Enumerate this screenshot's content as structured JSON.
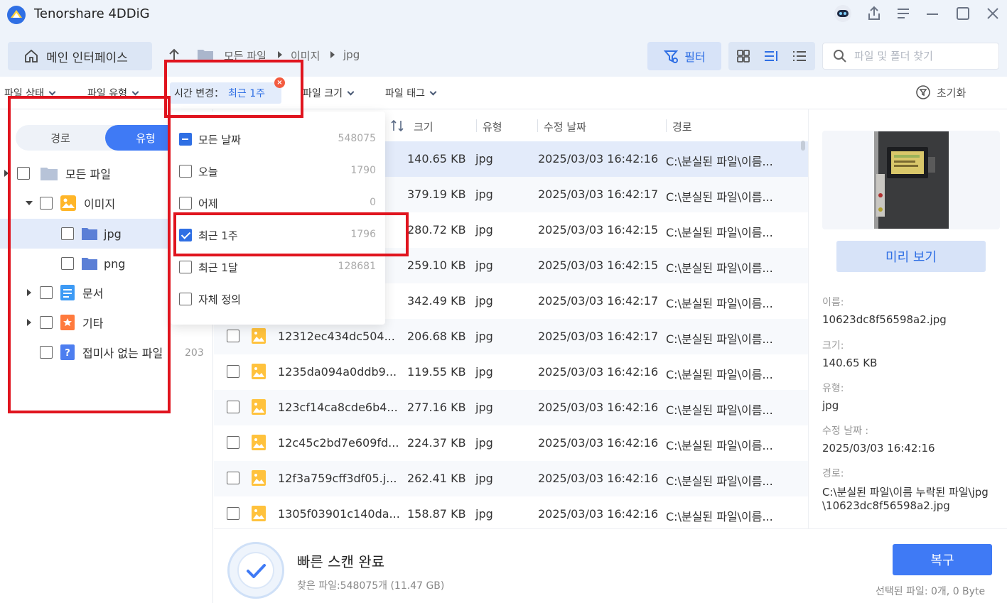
{
  "app": {
    "title": "Tenorshare 4DDiG"
  },
  "toolbar": {
    "home_label": "메인 인터페이스",
    "breadcrumb": [
      "모든 파일",
      "이미지",
      "jpg"
    ],
    "filter_label": "필터",
    "search_placeholder": "파일 및 폴더 찾기"
  },
  "filterbar": {
    "file_status": "파일 상태",
    "file_type": "파일 유형",
    "time_label": "시간 변경：",
    "time_value": "최근 1주",
    "file_size": "파일 크기",
    "file_tag": "파일 태그",
    "reset": "초기화"
  },
  "sidebar": {
    "tab_path": "경로",
    "tab_type": "유형",
    "items": [
      {
        "label": "모든 파일",
        "count": ""
      },
      {
        "label": "이미지",
        "count": ""
      },
      {
        "label": "jpg",
        "count": ""
      },
      {
        "label": "png",
        "count": ""
      },
      {
        "label": "문서",
        "count": ""
      },
      {
        "label": "기타",
        "count": ""
      },
      {
        "label": "접미사 없는 파일",
        "count": "203"
      }
    ]
  },
  "dropdown": {
    "options": [
      {
        "label": "모든 날짜",
        "count": "548075",
        "state": "partial"
      },
      {
        "label": "오늘",
        "count": "1790",
        "state": "unchecked"
      },
      {
        "label": "어제",
        "count": "0",
        "state": "unchecked"
      },
      {
        "label": "최근 1주",
        "count": "1796",
        "state": "checked"
      },
      {
        "label": "최근 1달",
        "count": "128681",
        "state": "unchecked"
      },
      {
        "label": "자체 정의",
        "count": "",
        "state": "unchecked"
      }
    ]
  },
  "table": {
    "columns": [
      "크기",
      "유형",
      "수정 날짜",
      "경로"
    ],
    "rows": [
      {
        "name": "",
        "size": "140.65 KB",
        "type": "jpg",
        "date": "2025/03/03 16:42:16",
        "path": "C:\\분실된 파일\\이름..."
      },
      {
        "name": "",
        "size": "379.19 KB",
        "type": "jpg",
        "date": "2025/03/03 16:42:17",
        "path": "C:\\분실된 파일\\이름..."
      },
      {
        "name": "",
        "size": "280.72 KB",
        "type": "jpg",
        "date": "2025/03/03 16:42:15",
        "path": "C:\\분실된 파일\\이름..."
      },
      {
        "name": "",
        "size": "259.10 KB",
        "type": "jpg",
        "date": "2025/03/03 16:42:15",
        "path": "C:\\분실된 파일\\이름..."
      },
      {
        "name": "",
        "size": "342.49 KB",
        "type": "jpg",
        "date": "2025/03/03 16:42:17",
        "path": "C:\\분실된 파일\\이름..."
      },
      {
        "name": "12312ec434dc504...",
        "size": "206.68 KB",
        "type": "jpg",
        "date": "2025/03/03 16:42:17",
        "path": "C:\\분실된 파일\\이름..."
      },
      {
        "name": "1235da094a0ddb9...",
        "size": "119.55 KB",
        "type": "jpg",
        "date": "2025/03/03 16:42:16",
        "path": "C:\\분실된 파일\\이름..."
      },
      {
        "name": "123cf14ca8cde6b4...",
        "size": "277.16 KB",
        "type": "jpg",
        "date": "2025/03/03 16:42:16",
        "path": "C:\\분실된 파일\\이름..."
      },
      {
        "name": "12c45c2bd7e609fd...",
        "size": "224.37 KB",
        "type": "jpg",
        "date": "2025/03/03 16:42:16",
        "path": "C:\\분실된 파일\\이름..."
      },
      {
        "name": "12f3a759cff3df05.j...",
        "size": "262.41 KB",
        "type": "jpg",
        "date": "2025/03/03 16:42:16",
        "path": "C:\\분실된 파일\\이름..."
      },
      {
        "name": "1305f03901c140da...",
        "size": "158.87 KB",
        "type": "jpg",
        "date": "2025/03/03 16:42:16",
        "path": "C:\\분실된 파일\\이름..."
      }
    ]
  },
  "details": {
    "preview_label": "미리 보기",
    "name_label": "이름:",
    "name_value": "10623dc8f56598a2.jpg",
    "size_label": "크기:",
    "size_value": "140.65 KB",
    "type_label": "유형:",
    "type_value": "jpg",
    "date_label": "수정 날짜 :",
    "date_value": "2025/03/03 16:42:16",
    "path_label": "경로:",
    "path_line1": "C:\\분실된 파일\\이름 누락된 파일\\jpg",
    "path_line2": "\\10623dc8f56598a2.jpg"
  },
  "bottom": {
    "scan_title": "빠른 스캔 완료",
    "scan_sub": "찾은 파일:548075개 (11.47 GB)",
    "recover_label": "복구",
    "selected_info": "선택된 파일: 0개, 0 Byte"
  },
  "colors": {
    "accent": "#3f7af5",
    "annotation": "#e0141e"
  }
}
